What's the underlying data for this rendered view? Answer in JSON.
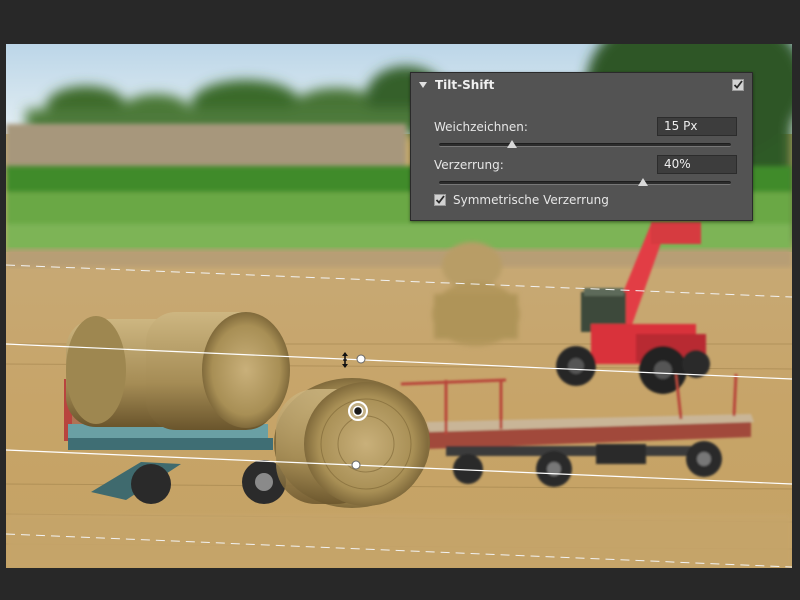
{
  "panel": {
    "title": "Tilt-Shift",
    "enabled": true,
    "blur": {
      "label": "Weichzeichnen:",
      "value": "15 Px",
      "level": 0.25
    },
    "distortion": {
      "label": "Verzerrung:",
      "value": "40%",
      "level": 0.7
    },
    "symmetric": {
      "label": "Symmetrische Verzerrung",
      "checked": true
    }
  },
  "colors": {
    "app_background": "#282828",
    "panel_background": "#535353",
    "field_background": "#3d3d3d"
  },
  "icons": [
    "disclosure-triangle-icon",
    "checkmark-icon",
    "focus-pin-icon",
    "rotate-handle-icon"
  ]
}
